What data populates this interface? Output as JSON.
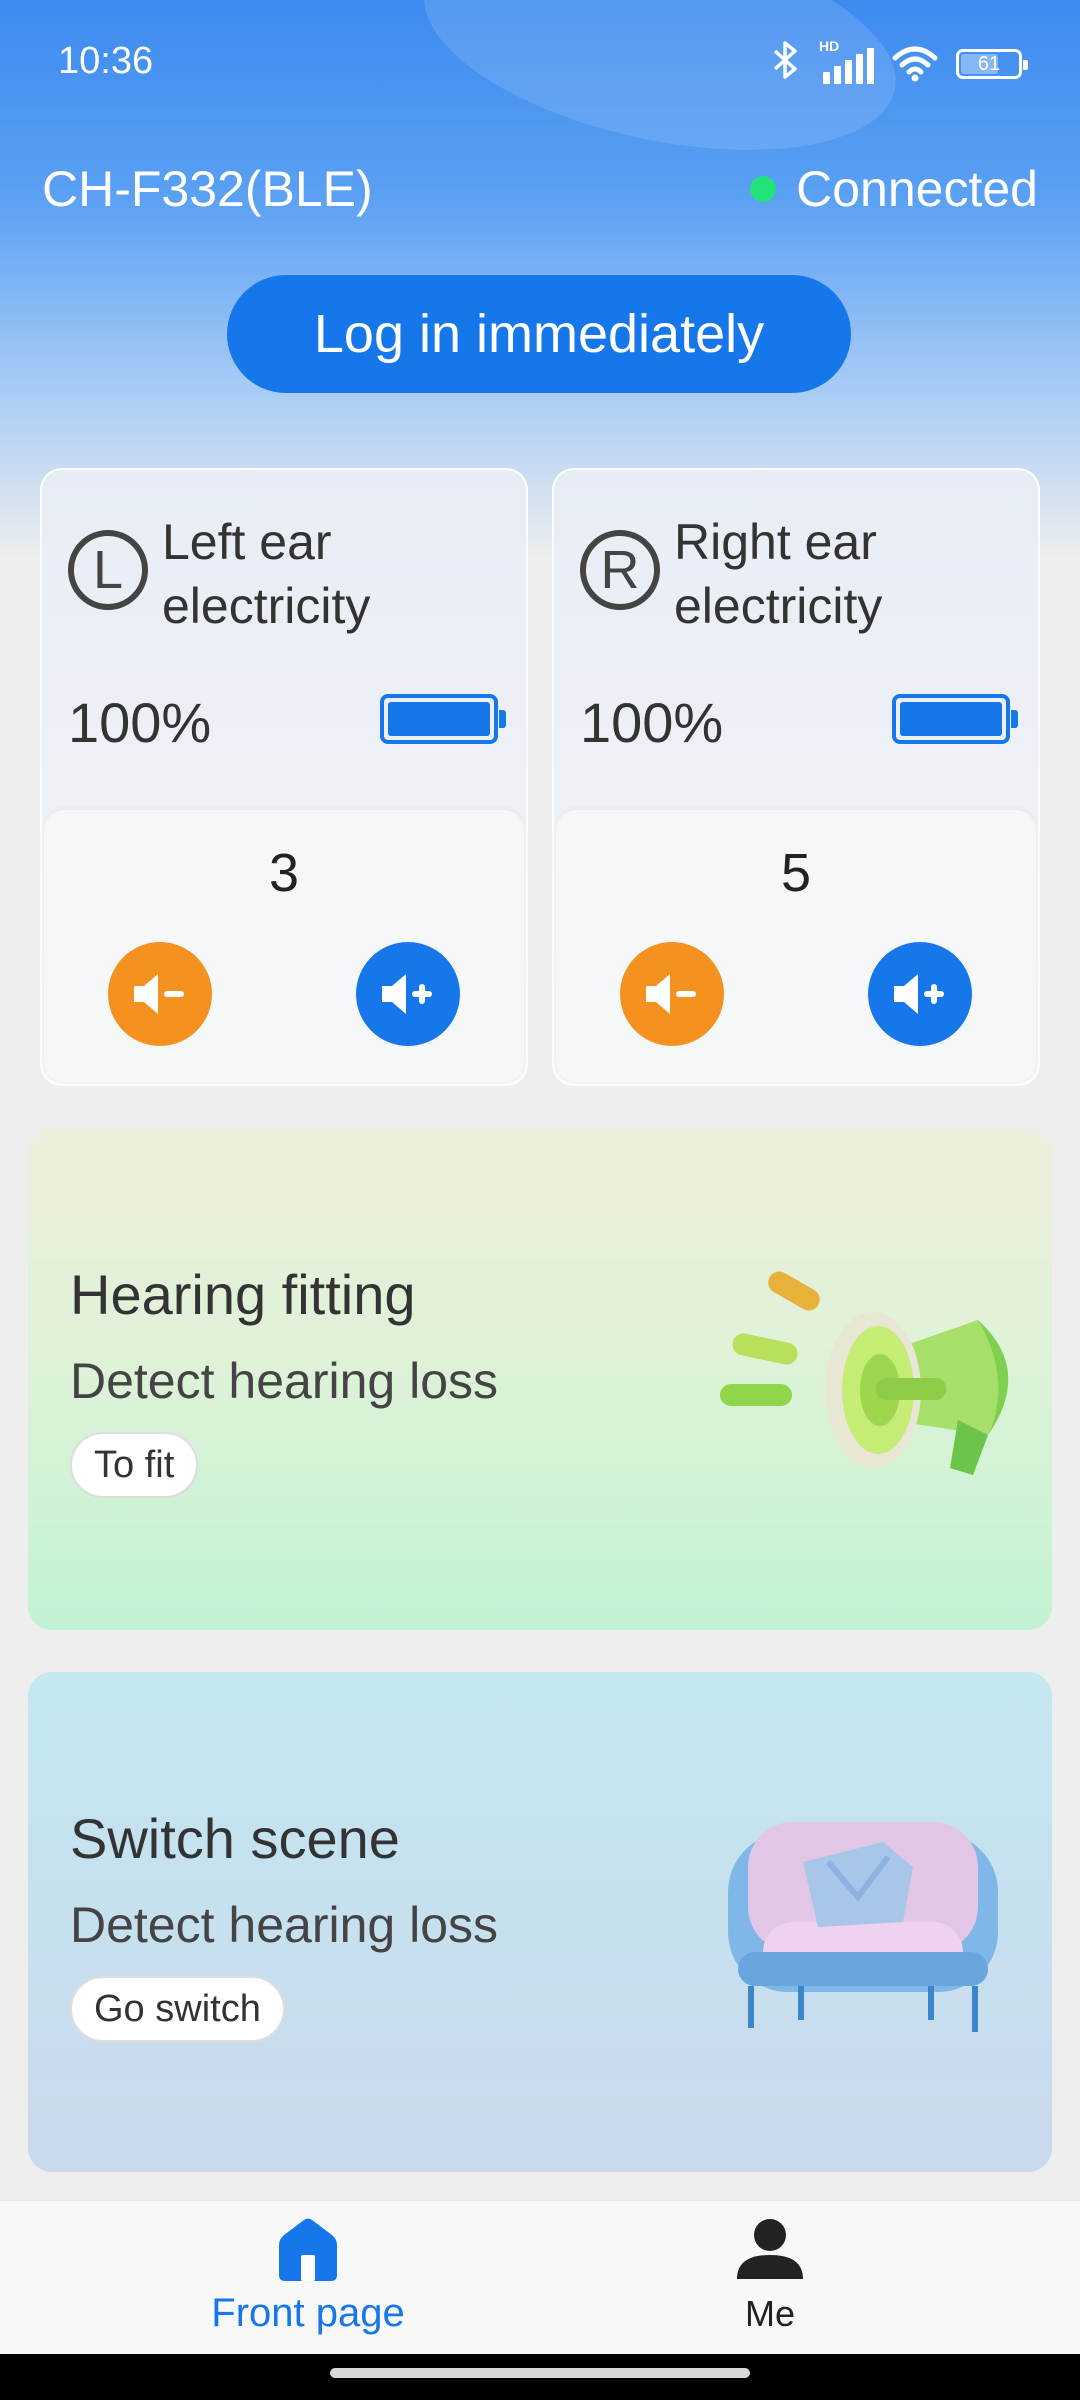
{
  "status_bar": {
    "time": "10:36",
    "network_tag": "HD",
    "battery_level": "61",
    "icons": [
      "bluetooth-icon",
      "signal-icon",
      "wifi-icon",
      "battery-icon"
    ]
  },
  "header": {
    "device_name": "CH-F332(BLE)",
    "connection_status": "Connected",
    "connection_color": "#22e37a"
  },
  "login_button": {
    "label": "Log in immediately"
  },
  "ears": {
    "left": {
      "badge": "L",
      "title": "Left ear electricity",
      "battery_percent": "100%",
      "battery_fraction": 1.0,
      "volume": "3"
    },
    "right": {
      "badge": "R",
      "title": "Right ear electricity",
      "battery_percent": "100%",
      "battery_fraction": 1.0,
      "volume": "5"
    }
  },
  "cards": {
    "fitting": {
      "title": "Hearing fitting",
      "subtitle": "Detect hearing loss",
      "button": "To fit",
      "illustration": "megaphone-illustration"
    },
    "scene": {
      "title": "Switch scene",
      "subtitle": "Detect hearing loss",
      "button": "Go switch",
      "illustration": "sofa-illustration"
    }
  },
  "tab_bar": {
    "home": {
      "label": "Front page",
      "icon": "home-icon",
      "active": true
    },
    "me": {
      "label": "Me",
      "icon": "person-icon",
      "active": false
    }
  },
  "colors": {
    "accent": "#1677ea",
    "volume_down": "#f5921f",
    "volume_up": "#1677ea"
  }
}
